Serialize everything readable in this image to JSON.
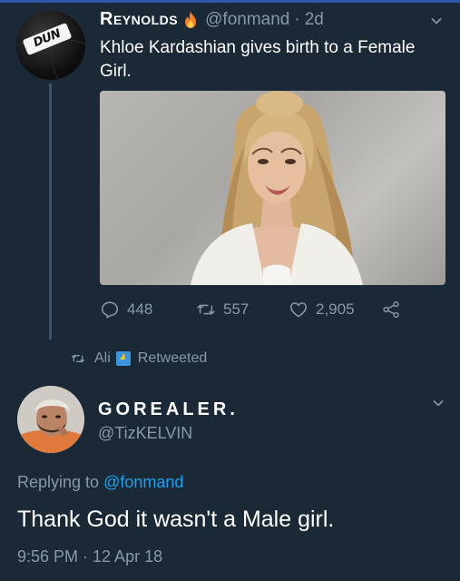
{
  "tweet1": {
    "author_name": "Reynolds",
    "handle": "@fonmand",
    "separator": "·",
    "age": "2d",
    "text": "Khloe Kardashian gives birth to a Female Girl.",
    "avatar_logo_text": "DUN",
    "actions": {
      "replies": "448",
      "retweets": "557",
      "likes": "2,905"
    }
  },
  "retweet_context": {
    "user": "Ali",
    "label": "Retweeted"
  },
  "tweet2": {
    "author_name": "GOREALER.",
    "handle": "@TizKELVIN",
    "replying_prefix": "Replying to",
    "replying_mention": "@fonmand",
    "text": "Thank God it wasn't a Male girl.",
    "timestamp": "9:56 PM · 12 Apr 18"
  },
  "colors": {
    "background": "#1b2836",
    "secondary_text": "#8899a6",
    "link": "#1da1f2",
    "thread_line": "#3d5466"
  },
  "icons": {
    "reply": "reply-icon",
    "retweet": "retweet-icon",
    "like": "heart-icon",
    "share": "share-icon",
    "menu": "chevron-down-icon",
    "fire": "fire-emoji-icon",
    "bolt": "lightning-emoji-icon"
  }
}
